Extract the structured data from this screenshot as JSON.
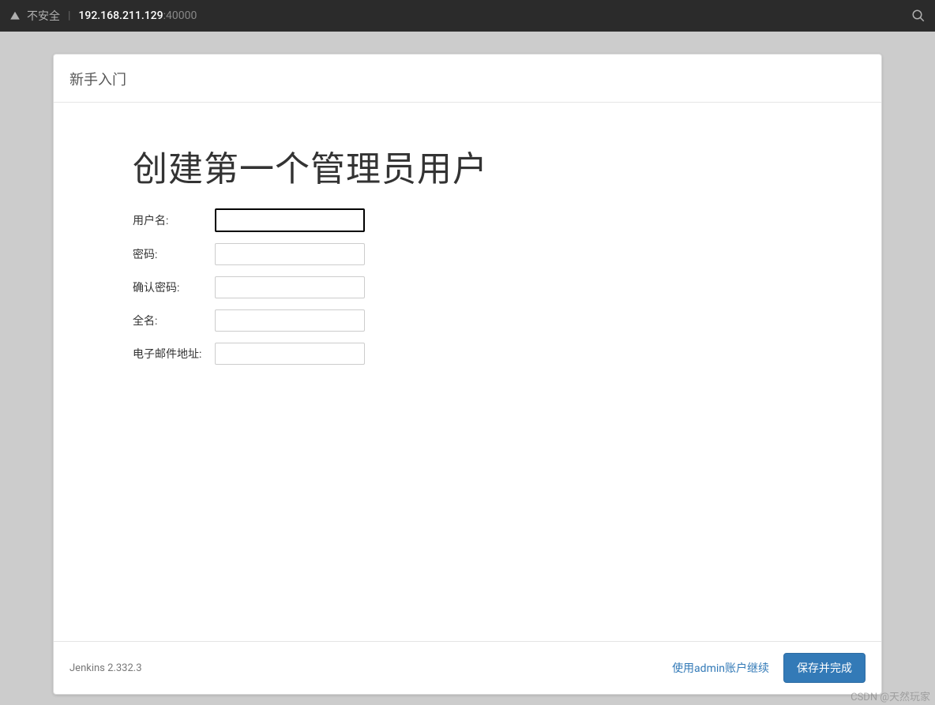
{
  "browser": {
    "insecure_label": "不安全",
    "url_host": "192.168.211.129",
    "url_port": ":40000"
  },
  "card": {
    "header_title": "新手入门",
    "form_title": "创建第一个管理员用户",
    "fields": {
      "username_label": "用户名:",
      "username_value": "",
      "password_label": "密码:",
      "password_value": "",
      "confirm_label": "确认密码:",
      "confirm_value": "",
      "fullname_label": "全名:",
      "fullname_value": "",
      "email_label": "电子邮件地址:",
      "email_value": ""
    }
  },
  "footer": {
    "version": "Jenkins 2.332.3",
    "skip_link": "使用admin账户继续",
    "save_button": "保存并完成"
  },
  "watermark": "CSDN @天然玩家"
}
